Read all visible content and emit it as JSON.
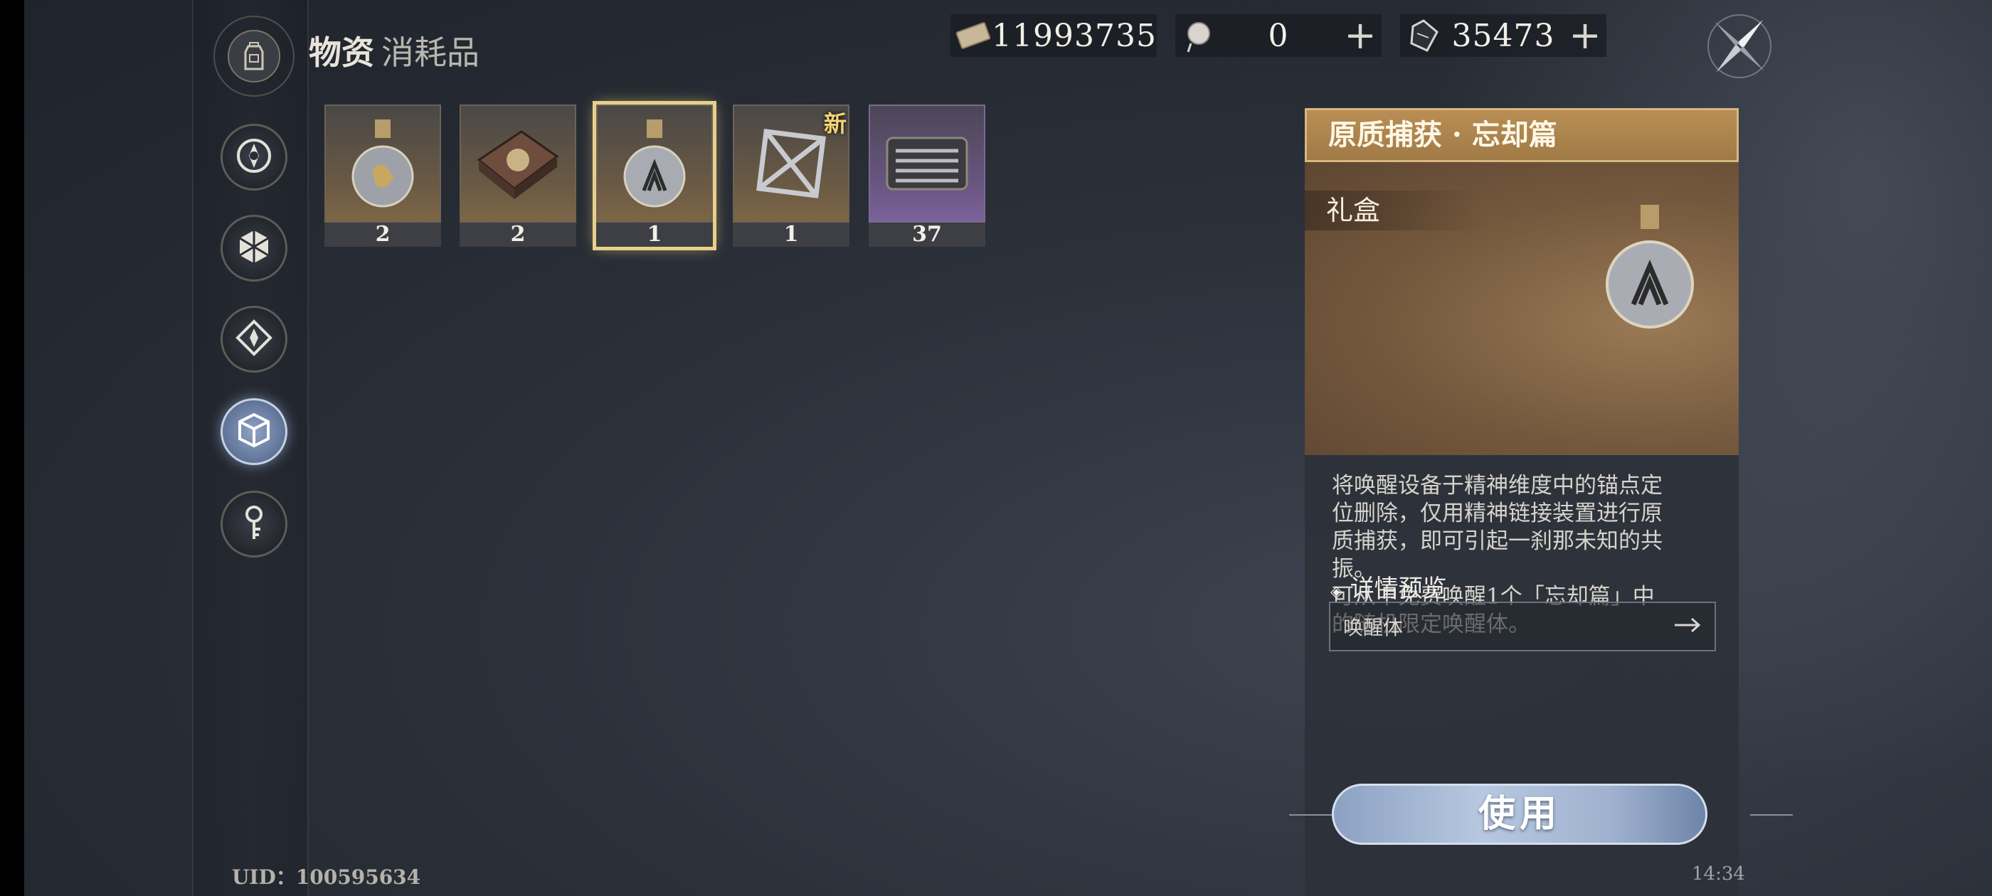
{
  "header": {
    "title": "物资",
    "subtitle": "消耗品"
  },
  "currencies": [
    {
      "icon": "ticket-icon",
      "value": "11993735",
      "has_plus": false
    },
    {
      "icon": "orb-icon",
      "value": "0",
      "has_plus": true
    },
    {
      "icon": "crystal-icon",
      "value": "35473",
      "has_plus": true
    }
  ],
  "plus_label": "+",
  "nav": [
    {
      "icon": "gear-emblem-icon",
      "active": false
    },
    {
      "icon": "hexagon-icon",
      "active": false
    },
    {
      "icon": "diamond-icon",
      "active": false
    },
    {
      "icon": "cube-icon",
      "active": true
    },
    {
      "icon": "key-icon",
      "active": false
    }
  ],
  "items": [
    {
      "name": "flask-item",
      "count": "2",
      "selected": false,
      "new": false,
      "rarity": "gold"
    },
    {
      "name": "book-item",
      "count": "2",
      "selected": false,
      "new": false,
      "rarity": "gold"
    },
    {
      "name": "flask-item",
      "count": "1",
      "selected": true,
      "new": false,
      "rarity": "gold"
    },
    {
      "name": "cube-frame-item",
      "count": "1",
      "selected": false,
      "new": true,
      "rarity": "gold"
    },
    {
      "name": "tool-kit-item",
      "count": "37",
      "selected": false,
      "new": false,
      "rarity": "purple"
    }
  ],
  "new_badge": "新",
  "detail": {
    "title": "原质捕获 · 忘却篇",
    "category": "礼盒",
    "description": "将唤醒设备于精神维度中的锚点定\n位删除，仅用精神链接装置进行原\n质捕获，即可引起一刹那未知的共\n振。\n可从中免费唤醒1个「忘却篇」中\n的随机限定唤醒体。",
    "preview_label": "详情预览",
    "preview_item": "唤醒体",
    "use_button": "使用"
  },
  "footer": {
    "uid": "UID：100595634",
    "time": "14:34"
  },
  "colors": {
    "accent_gold": "#e8cf8a",
    "panel_title": "#b98e55",
    "use_button": "#9fb1ce"
  }
}
